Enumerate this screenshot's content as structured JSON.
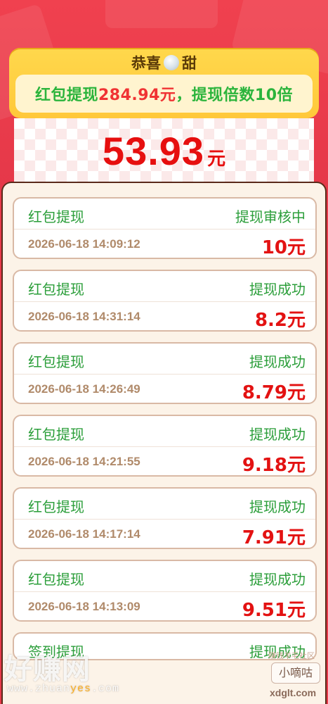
{
  "header": {
    "congrats_left": "恭喜",
    "congrats_right": "甜",
    "banner_prefix": "红包提现",
    "banner_amount": "284.94元",
    "banner_suffix": "，提现倍数10倍"
  },
  "balance": {
    "amount": "53.93",
    "unit": "元"
  },
  "records": [
    {
      "title": "红包提现",
      "status": "提现审核中",
      "time": "2026-06-18 14:09:12",
      "amount": "10元"
    },
    {
      "title": "红包提现",
      "status": "提现成功",
      "time": "2026-06-18 14:31:14",
      "amount": "8.2元"
    },
    {
      "title": "红包提现",
      "status": "提现成功",
      "time": "2026-06-18 14:26:49",
      "amount": "8.79元"
    },
    {
      "title": "红包提现",
      "status": "提现成功",
      "time": "2026-06-18 14:21:55",
      "amount": "9.18元"
    },
    {
      "title": "红包提现",
      "status": "提现成功",
      "time": "2026-06-18 14:17:14",
      "amount": "7.91元"
    },
    {
      "title": "红包提现",
      "status": "提现成功",
      "time": "2026-06-18 14:13:09",
      "amount": "9.51元"
    },
    {
      "title": "签到提现",
      "status": "提现成功"
    }
  ],
  "watermarks": {
    "left_logo": "好赚网",
    "left_url_a": "www.zhuan",
    "left_url_b": "yes",
    "left_url_c": ".com",
    "right_small": "赚钱羊毛社区",
    "right_box": "小嘀咕",
    "right_url": "xdglt.com"
  },
  "colors": {
    "background_red": "#e8394a",
    "header_yellow": "#ffd84c",
    "status_green": "#2b9e3a",
    "amount_red": "#e31212"
  }
}
